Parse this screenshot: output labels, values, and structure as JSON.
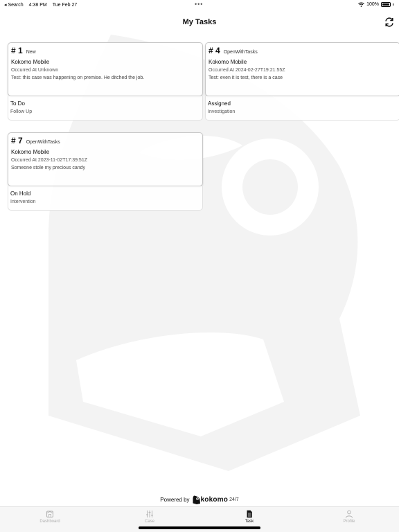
{
  "status_bar": {
    "back_app": "Search",
    "time": "4:38 PM",
    "date": "Tue Feb 27",
    "dots": "•••",
    "battery": "100%"
  },
  "header": {
    "title": "My Tasks"
  },
  "tasks": [
    {
      "number": "# 1",
      "state": "New",
      "org": "Kokomo Mobile",
      "occurred": "Occurred At Unknown",
      "description": "Test: this case was happening on premise. He ditched the job.",
      "status": "To Do",
      "substatus": "Follow Up"
    },
    {
      "number": "# 4",
      "state": "OpenWithTasks",
      "org": "Kokomo Mobile",
      "occurred": "Occurred At 2024-02-27T19:21:55Z",
      "description": "Test: even it is test, there is a case",
      "status": "Assigned",
      "substatus": "Investigation"
    },
    {
      "number": "# 7",
      "state": "OpenWithTasks",
      "org": "Kokomo Mobile",
      "occurred": "Occurred At 2023-11-02T17:39:51Z",
      "description": "Someone stole my precious candy",
      "status": "On Hold",
      "substatus": "Intervention"
    }
  ],
  "footer": {
    "powered_by": "Powered by",
    "brand": "kokomo",
    "brand_suffix": "24/7"
  },
  "tabbar": {
    "dashboard": "Dashboard",
    "case": "Case",
    "task": "Task",
    "profile": "Profile"
  },
  "icons": {
    "refresh": "refresh-icon",
    "wifi": "wifi-icon",
    "battery": "battery-icon",
    "dashboard": "home-icon",
    "case": "sliders-icon",
    "task": "document-icon",
    "profile": "person-icon",
    "brand": "parrot-logo-icon"
  },
  "colors": {
    "active_tab": "#111111",
    "inactive_tab": "#b0b0b0",
    "watermark": "#f2f2f2"
  }
}
